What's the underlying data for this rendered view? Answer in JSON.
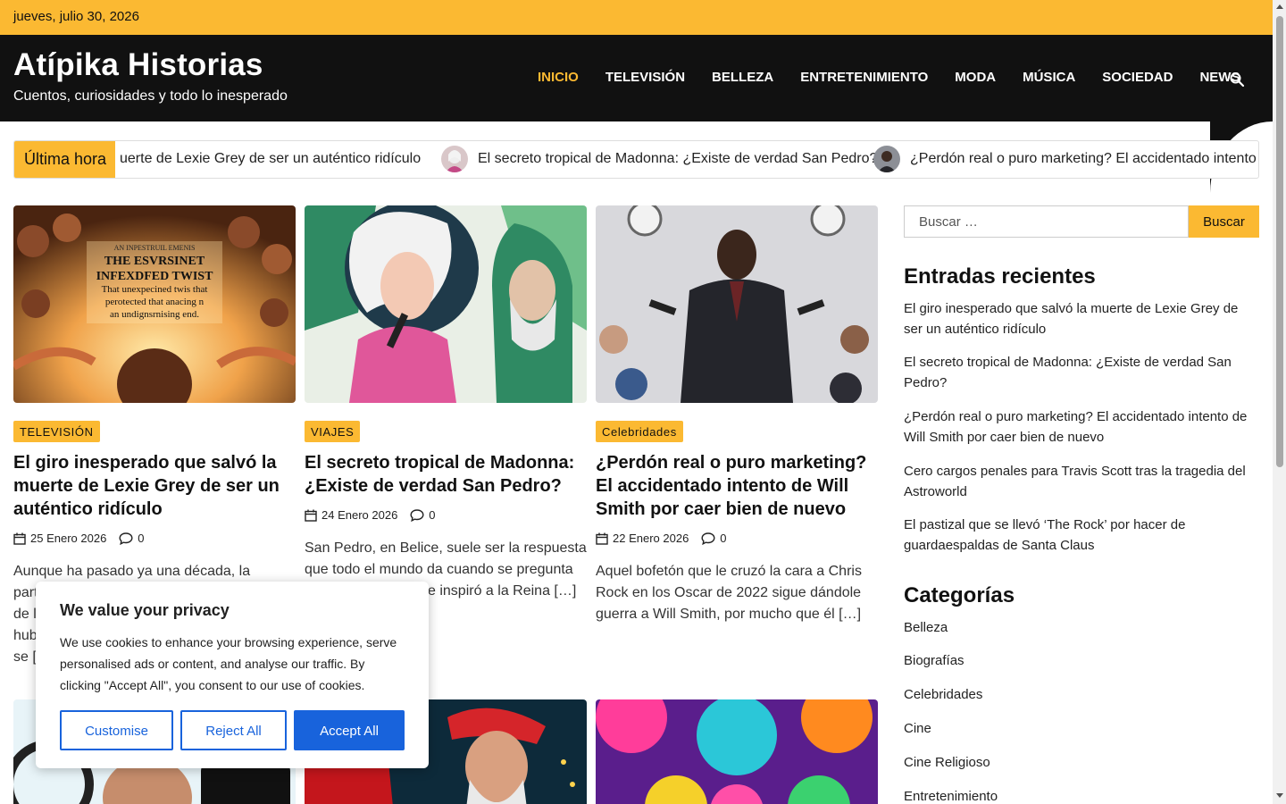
{
  "topbar": {
    "date": "jueves, julio 30, 2026"
  },
  "header": {
    "title": "Atípika Historias",
    "description": "Cuentos, curiosidades y todo lo inesperado",
    "nav": [
      "INICIO",
      "TELEVISIÓN",
      "BELLEZA",
      "ENTRETENIMIENTO",
      "MODA",
      "MÚSICA",
      "SOCIEDAD",
      "NEWS"
    ],
    "search_icon": "search-icon"
  },
  "ticker": {
    "label": "Última hora",
    "items": [
      "uerte de Lexie Grey de ser un auténtico ridículo",
      "El secreto tropical de Madonna: ¿Existe de verdad San Pedro?",
      "¿Perdón real o puro marketing? El accidentado intento de Wi"
    ]
  },
  "posts": [
    {
      "category": "TELEVISIÓN",
      "title": "El giro inesperado que salvó la muerte de Lexie Grey de ser un auténtico ridículo",
      "date": "25 Enero 2026",
      "comments": "0",
      "excerpt": "Aunque ha pasado ya una década, la partida de l",
      "excerpt_lines": [
        "Aunque ha pasado ya una década, la partida",
        "de l",
        "hub",
        "se ["
      ]
    },
    {
      "category": "VIAJES",
      "title": "El secreto tropical de Madonna: ¿Existe de verdad San Pedro?",
      "date": "24 Enero 2026",
      "comments": "0",
      "excerpt_lines": [
        "San Pedro, en Belice, suele ser la respuesta",
        "que todo el mundo da cuando se pregunta",
        "e inspiró a la Reina […]"
      ]
    },
    {
      "category": "Celebridades",
      "title": "¿Perdón real o puro marketing? El accidentado intento de Will Smith por caer bien de nuevo",
      "date": "22 Enero 2026",
      "comments": "0",
      "excerpt_lines": [
        "Aquel bofetón que le cruzó la cara a Chris",
        "Rock en los Oscar de 2022 sigue dándole",
        "guerra a Will Smith, por mucho que él […]"
      ]
    }
  ],
  "sidebar": {
    "search_placeholder": "Buscar …",
    "search_button": "Buscar",
    "recent_title": "Entradas recientes",
    "recent": [
      "El giro inesperado que salvó la muerte de Lexie Grey de ser un auténtico ridículo",
      "El secreto tropical de Madonna: ¿Existe de verdad San Pedro?",
      "¿Perdón real o puro marketing? El accidentado intento de Will Smith por caer bien de nuevo",
      "Cero cargos penales para Travis Scott tras la tragedia del Astroworld",
      "El pastizal que se llevó ‘The Rock’ por hacer de guardaespaldas de Santa Claus"
    ],
    "categories_title": "Categorías",
    "categories": [
      "Belleza",
      "Biografías",
      "Celebridades",
      "Cine",
      "Cine Religioso",
      "Entretenimiento"
    ]
  },
  "cookie": {
    "title": "We value your privacy",
    "text": "We use cookies to enhance your browsing experience, serve personalised ads or content, and analyse our traffic. By clicking \"Accept All\", you consent to our use of cookies.",
    "customise": "Customise",
    "reject": "Reject All",
    "accept": "Accept All"
  },
  "colors": {
    "accent": "#fbb932",
    "header_bg": "#111111",
    "cookie_blue": "#1863dc"
  },
  "image_text": {
    "post1": [
      "AN INPESTRUIL EMENIS",
      "THE ESVRSINET",
      "INFEXDFED TWIST",
      "That unexpecined twis that",
      "perotected that anacing n",
      "an undignsrnising end."
    ]
  }
}
